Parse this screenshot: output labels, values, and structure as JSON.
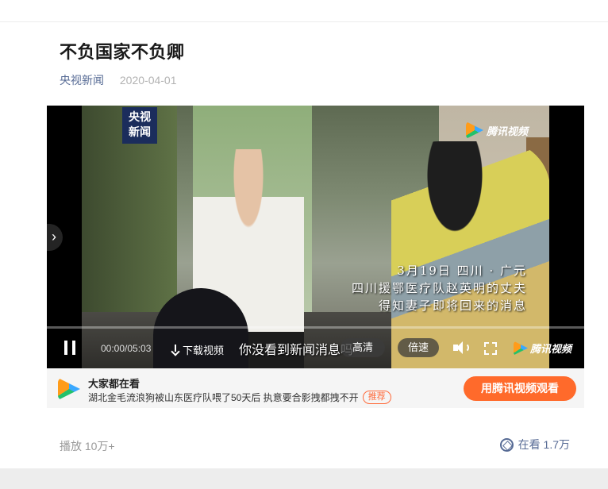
{
  "article": {
    "title": "不负国家不负卿",
    "source": "央视新闻",
    "date": "2020-04-01"
  },
  "player": {
    "cctv_logo_line1": "央视",
    "cctv_logo_line2": "新闻",
    "watermark": "腾讯视频",
    "caption_lines": [
      "3月19日 四川 · 广元",
      "四川援鄂医疗队赵英明的丈夫",
      "得知妻子即将回来的消息"
    ],
    "time": "00:00/05:03",
    "download_label": "下载视频",
    "subtitle": "你没看到新闻消息吗",
    "quality_label": "高清",
    "speed_label": "倍速",
    "brand": "腾讯视频",
    "progress": 0.0
  },
  "promo": {
    "heading": "大家都在看",
    "recommend_text": "湖北金毛流浪狗被山东医疗队喂了50天后 执意要合影拽都拽不开",
    "tag": "推荐",
    "button_label": "用腾讯视频观看"
  },
  "stats": {
    "plays": "播放 10万+",
    "watching": "在看 1.7万"
  }
}
